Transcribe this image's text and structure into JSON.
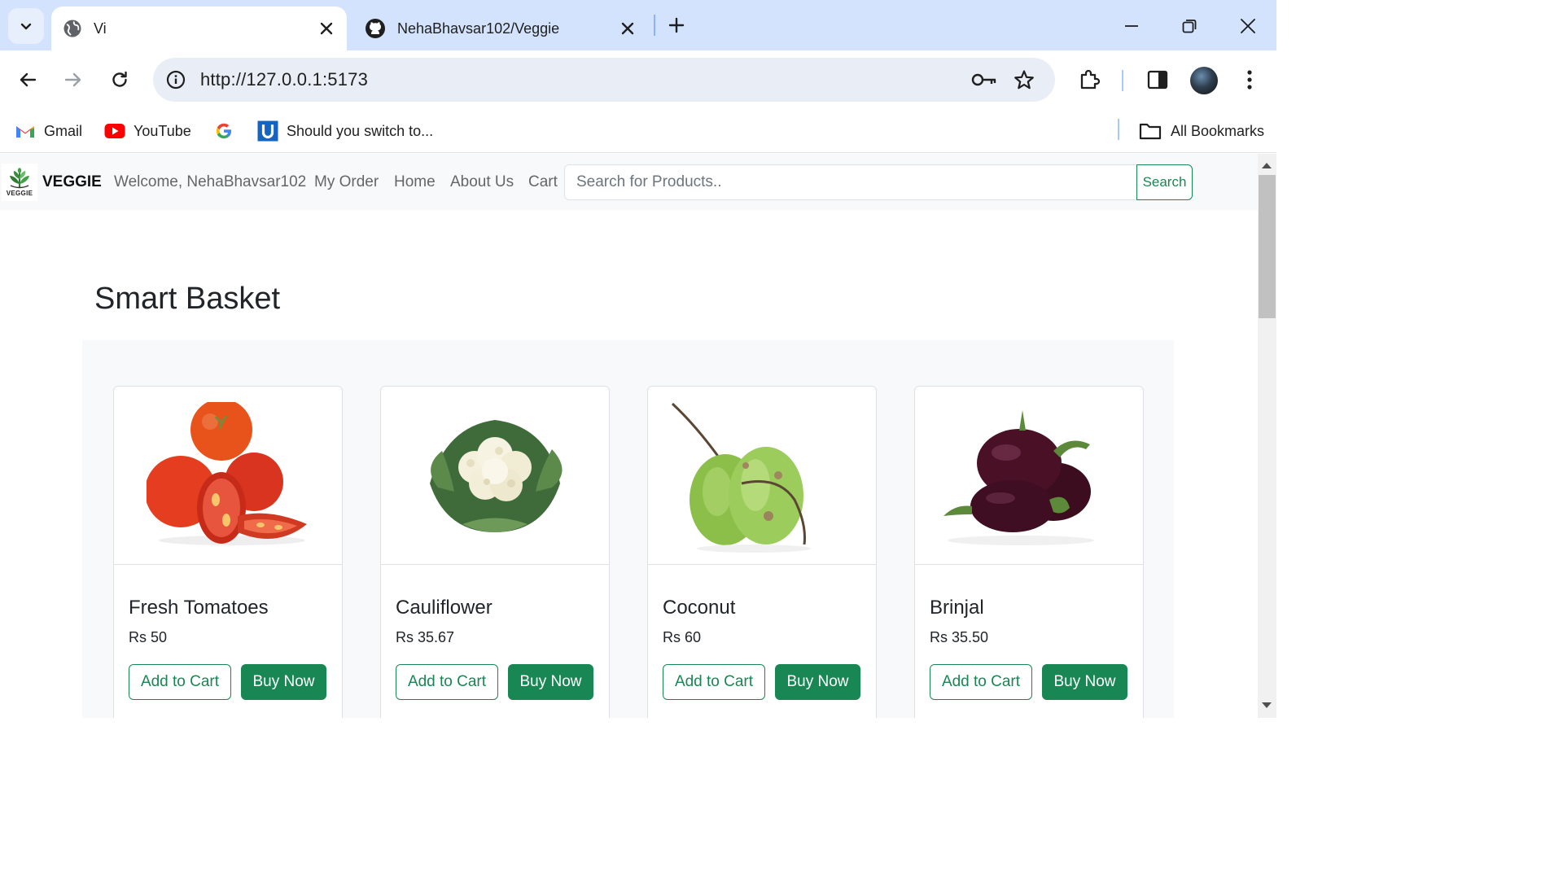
{
  "browser": {
    "tabs": [
      {
        "title": "Vi"
      },
      {
        "title": "NehaBhavsar102/Veggie"
      }
    ],
    "url": "http://127.0.0.1:5173",
    "bookmarks": [
      {
        "label": "Gmail"
      },
      {
        "label": "YouTube"
      },
      {
        "label": ""
      },
      {
        "label": "Should you switch to..."
      }
    ],
    "all_bookmarks_label": "All Bookmarks"
  },
  "navbar": {
    "logo_text": "VEGGIE",
    "brand": "VEGGIE",
    "welcome": "Welcome, NehaBhavsar102",
    "links": [
      "My Order",
      "Home",
      "About Us",
      "Cart"
    ],
    "search_placeholder": "Search for Products..",
    "search_button": "Search"
  },
  "main": {
    "heading": "Smart Basket",
    "products": [
      {
        "name": "Fresh Tomatoes",
        "price": "Rs 50",
        "image": "tomato-image"
      },
      {
        "name": "Cauliflower",
        "price": "Rs 35.67",
        "image": "cauliflower-image"
      },
      {
        "name": "Coconut",
        "price": "Rs 60",
        "image": "coconut-image"
      },
      {
        "name": "Brinjal",
        "price": "Rs 35.50",
        "image": "brinjal-image"
      }
    ],
    "add_to_cart_label": "Add to Cart",
    "buy_now_label": "Buy Now"
  },
  "colors": {
    "brand_green": "#198754",
    "tabbar_bg": "#d3e3fd",
    "omnibox_bg": "#e9eef6",
    "navbar_bg": "#f8f9fa"
  }
}
